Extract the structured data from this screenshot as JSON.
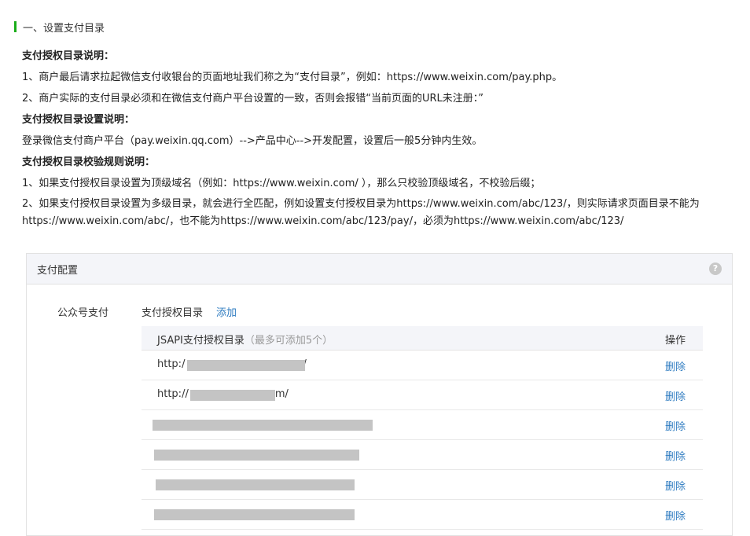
{
  "section": {
    "title": "一、设置支付目录"
  },
  "doc": {
    "h1": "支付授权目录说明：",
    "p1": "1、商户最后请求拉起微信支付收银台的页面地址我们称之为“支付目录”，例如：https://www.weixin.com/pay.php。",
    "p2": "2、商户实际的支付目录必须和在微信支付商户平台设置的一致，否则会报错“当前页面的URL未注册：”",
    "h2": "支付授权目录设置说明：",
    "p3": "登录微信支付商户平台（pay.weixin.qq.com）-->产品中心-->开发配置，设置后一般5分钟内生效。",
    "h3": "支付授权目录校验规则说明：",
    "p4": "1、如果支付授权目录设置为顶级域名（例如：https://www.weixin.com/ ），那么只校验顶级域名，不校验后缀；",
    "p5": "2、如果支付授权目录设置为多级目录，就会进行全匹配，例如设置支付授权目录为https://www.weixin.com/abc/123/，则实际请求页面目录不能为https://www.weixin.com/abc/，也不能为https://www.weixin.com/abc/123/pay/，必须为https://www.weixin.com/abc/123/"
  },
  "panel": {
    "title": "支付配置",
    "help_icon": "?",
    "row_label": "公众号支付",
    "dir_label": "支付授权目录",
    "add_label": "添加",
    "table": {
      "col1": "JSAPI支付授权目录",
      "col1_note": "（最多可添加5个）",
      "col2": "操作",
      "rows": [
        {
          "url_prefix": "http:/",
          "url_suffix": "/",
          "delete": "删除"
        },
        {
          "url_prefix": "http://",
          "url_suffix": "m/",
          "delete": "删除"
        },
        {
          "url_prefix": "",
          "url_suffix": "",
          "delete": "删除"
        },
        {
          "url_prefix": "",
          "url_suffix": "",
          "delete": "删除"
        },
        {
          "url_prefix": "",
          "url_suffix": "",
          "delete": "删除"
        },
        {
          "url_prefix": "",
          "url_suffix": "",
          "delete": "删除"
        }
      ]
    }
  }
}
